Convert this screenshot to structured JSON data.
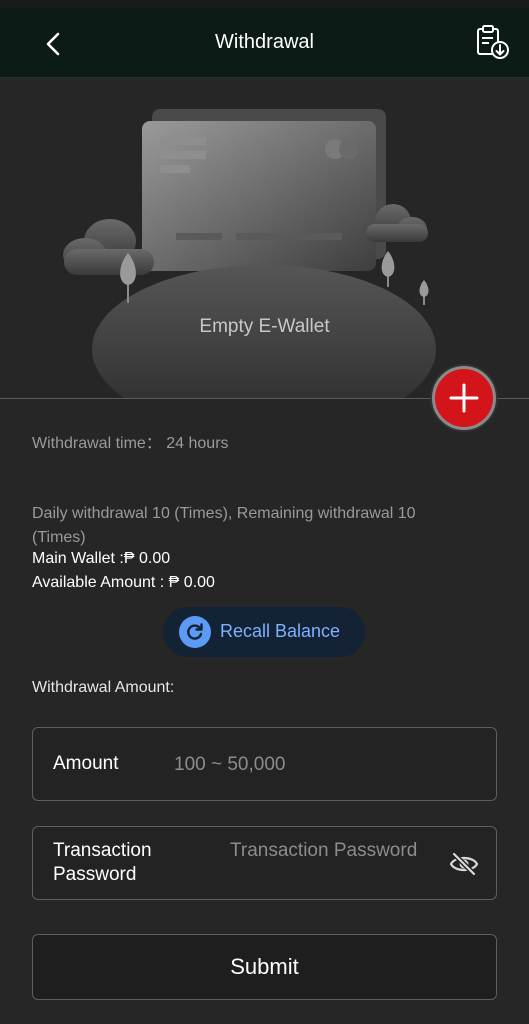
{
  "header": {
    "title": "Withdrawal",
    "back_icon": "chevron-left-icon",
    "records_icon": "clipboard-download-icon"
  },
  "hero": {
    "empty_label": "Empty E-Wallet",
    "add_icon": "plus-icon"
  },
  "info": {
    "withdrawal_time": "Withdrawal time：  24 hours",
    "daily_limit": "Daily withdrawal 10 (Times), Remaining withdrawal 10 (Times)",
    "main_wallet": "Main Wallet :₱ 0.00",
    "available_amount": "Available Amount : ₱ 0.00"
  },
  "recall": {
    "label": "Recall Balance",
    "icon": "refresh-icon"
  },
  "form": {
    "section_label": "Withdrawal Amount:",
    "amount_label": "Amount",
    "amount_placeholder": "100 ~ 50,000",
    "password_label": "Transaction Password",
    "password_placeholder": "Transaction Password",
    "eye_icon": "eye-off-icon",
    "submit_label": "Submit"
  },
  "colors": {
    "header_bg": "#0d1b16",
    "page_bg": "#262626",
    "add_button": "#d3151b",
    "recall_bg": "#132235",
    "recall_text": "#7fb1ff"
  }
}
